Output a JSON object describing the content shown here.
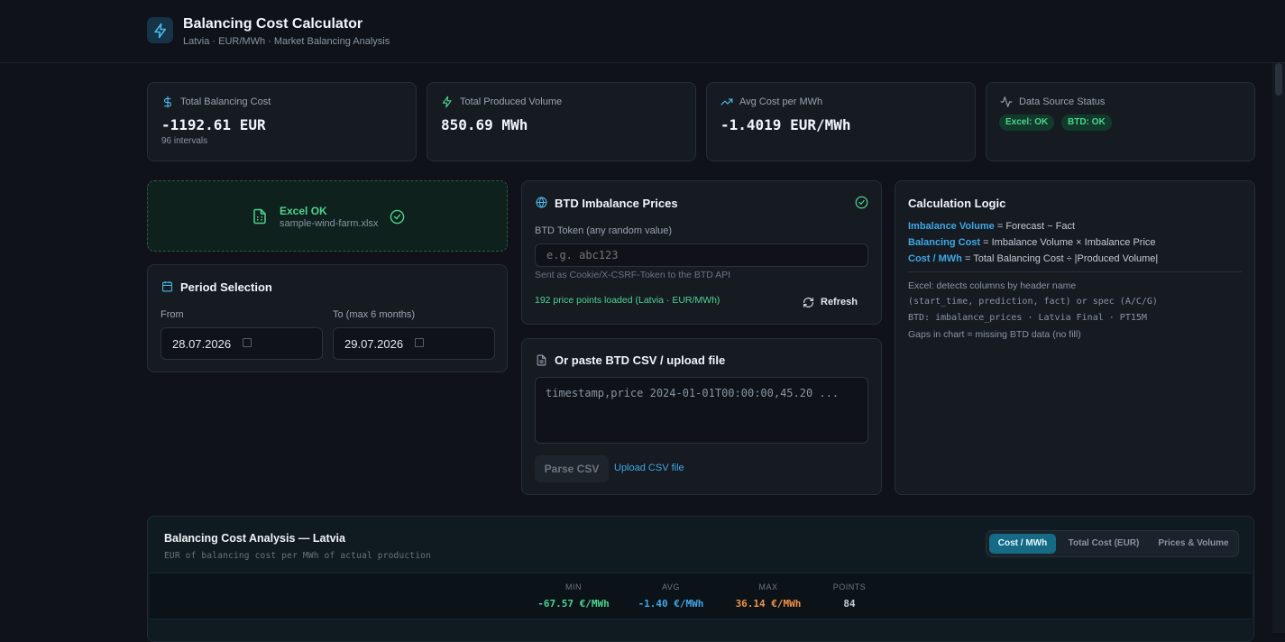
{
  "header": {
    "title": "Balancing Cost Calculator",
    "subtitle": "Latvia · EUR/MWh · Market Balancing Analysis"
  },
  "stats": {
    "total_cost": {
      "label": "Total Balancing Cost",
      "value": "-1192.61 EUR",
      "note": "96 intervals",
      "icon": "dollar-icon"
    },
    "total_volume": {
      "label": "Total Produced Volume",
      "value": "850.69 MWh",
      "icon": "bolt-icon"
    },
    "avg_cost": {
      "label": "Avg Cost per MWh",
      "value": "-1.4019 EUR/MWh",
      "icon": "trending-up-icon"
    },
    "data_status": {
      "label": "Data Source Status",
      "badges": [
        "Excel: OK",
        "BTD: OK"
      ],
      "icon": "activity-icon"
    }
  },
  "excel": {
    "status": "Excel OK",
    "filename": "sample-wind-farm.xlsx"
  },
  "period": {
    "title": "Period Selection",
    "from_label": "From",
    "to_label": "To (max 6 months)",
    "from_value": "28.07.2026",
    "to_value": "29.07.2026"
  },
  "btd": {
    "title": "BTD Imbalance Prices",
    "token_label": "BTD Token (any random value)",
    "token_placeholder": "e.g. abc123",
    "token_hint": "Sent as Cookie/X-CSRF-Token to the BTD API",
    "loaded_status": "192 price points loaded (Latvia · EUR/MWh)",
    "refresh_label": "Refresh"
  },
  "csv": {
    "title": "Or paste BTD CSV / upload file",
    "placeholder": "timestamp,price 2024-01-01T00:00:00,45.20 ...",
    "parse_label": "Parse CSV",
    "upload_label": "Upload CSV file"
  },
  "logic": {
    "title": "Calculation Logic",
    "lines": [
      {
        "term": "Imbalance Volume",
        "rest": " = Forecast − Fact"
      },
      {
        "term": "Balancing Cost",
        "rest": " = Imbalance Volume × Imbalance Price"
      },
      {
        "term": "Cost / MWh",
        "rest": " = Total Balancing Cost ÷ |Produced Volume|"
      }
    ],
    "notes": [
      "Excel: detects columns by header name",
      "(start_time, prediction, fact) or spec (A/C/G)",
      "BTD: imbalance_prices · Latvia Final · PT15M",
      "Gaps in chart = missing BTD data (no fill)"
    ]
  },
  "analysis": {
    "title": "Balancing Cost Analysis — Latvia",
    "subtitle": "EUR of balancing cost per MWh of actual production",
    "tabs": [
      "Cost / MWh",
      "Total Cost (EUR)",
      "Prices & Volume"
    ],
    "active_tab": 0,
    "stats": [
      {
        "label": "MIN",
        "value": "-67.57 €/MWh",
        "color": "#4ed38f"
      },
      {
        "label": "AVG",
        "value": "-1.40 €/MWh",
        "color": "#3fa7e6"
      },
      {
        "label": "MAX",
        "value": "36.14 €/MWh",
        "color": "#f0924a"
      },
      {
        "label": "POINTS",
        "value": "84",
        "color": "#c4cad3"
      }
    ]
  }
}
